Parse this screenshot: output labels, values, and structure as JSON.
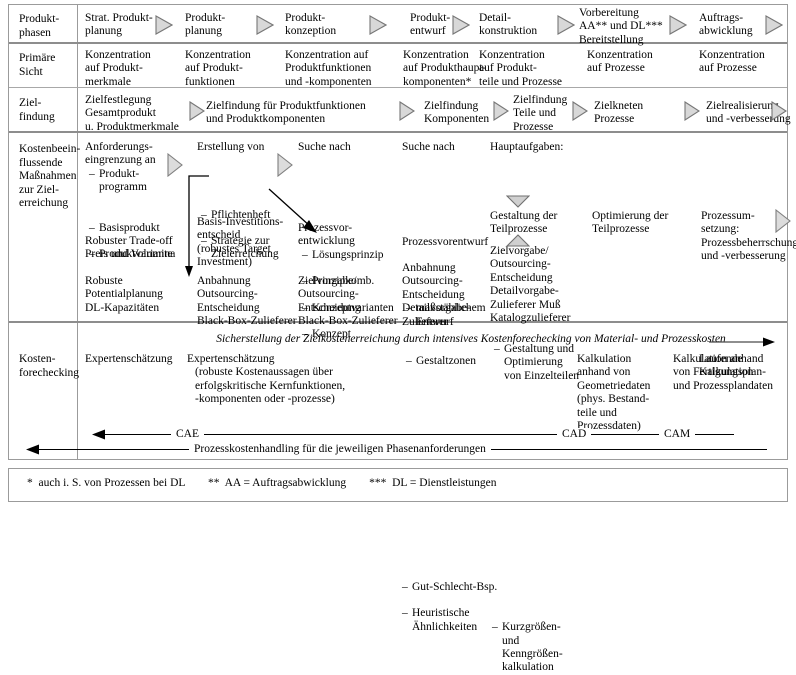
{
  "rows": {
    "produktphasen": {
      "label": "Produkt-\nphasen",
      "cells": [
        "Strat. Produkt-\nplanung",
        "Produkt-\nplanung",
        "Produkt-\nkonzeption",
        "Produkt-\nentwurf",
        "Detail-\nkonstruktion",
        "Vorbereitung\nAA** und DL***\nBereitstellung",
        "Auftrags-\nabwicklung"
      ]
    },
    "primaere_sicht": {
      "label": "Primäre\nSicht",
      "cells": [
        "Konzentration\nauf Produkt-\nmerkmale",
        "Konzentration\nauf Produkt-\nfunktionen",
        "Konzentration auf\nProduktfunktionen\nund -komponenten",
        "Konzentration\nauf Produkthaupt-\nkomponenten*",
        "Konzentration\nauf Produkt-\nteile und Prozesse",
        "Konzentration\nauf Prozesse",
        "Konzentration\nauf Prozesse"
      ]
    },
    "zielfindung": {
      "label": "Ziel-\nfindung",
      "cells": [
        "Zielfestlegung\nGesamtprodukt\nu. Produktmerkmale",
        "Zielfindung für Produktfunktionen\nund Produktkomponenten",
        "Zielfindung\nKomponenten",
        "Zielfindung\nTeile und\nProzesse",
        "Zielkneten\nProzesse",
        "Zielrealisierung\nund -verbesserung"
      ]
    },
    "massnahmen": {
      "label": "Kostenbeein-\nflussende\nMaßnahmen\nzur Ziel-\nerreichung",
      "c1_head": "Anforderungs-\neingrenzung an",
      "c1_items": [
        "Produkt-\nprogramm",
        "Basisprodukt",
        "Produktvariante"
      ],
      "c1_b": "Robuster Trade-off\nPreis und Volumina",
      "c1_c": "Robuste\nPotentialplanung\nDL-Kapazitäten",
      "c2_head": "Erstellung von",
      "c2_items": [
        "Pflichtenheft",
        "Strategie zur\nZielerreichung"
      ],
      "c2_b": "Basis-Investitions-\nentscheid\n(robustes Target\nInvestment)",
      "c2_c": "Anbahnung\nOutsourcing-\nEntscheidung\nBlack-Box-Zulieferer",
      "c3_head": "Suche nach",
      "c3_items": [
        "Lösungsprinzip",
        "Prinzipkomb.",
        "Konzeptvarianten",
        "Konzept"
      ],
      "c3_b": "Prozessvor-\nentwicklung",
      "c3_c": "Zielvorgabe/\nOutsourcing-\nEntscheidung\nBlack-Box-Zulieferer",
      "c4_head": "Suche nach",
      "c4_items": [
        "maßstäblichem\nEntwurf",
        "Gestaltzonen"
      ],
      "c4_b": "Prozessvorentwurf",
      "c5_head": "Hauptaufgaben:",
      "c5_items": [
        "Gestaltung und\nOptimierung\nvon Einzelteilen"
      ],
      "c5_b": "Gestaltung der\nTeilprozesse",
      "c5_c": "Zielvorgabe/\nOutsourcing-\nEntscheidung\nDetailvorgabe-\nZulieferer Muß\nKatalogzulieferer",
      "c6_b": "Optimierung der\nTeilprozesse",
      "c7_b": "Prozessum-\nsetzung:\nProzessbeherrschung\nund -verbesserung",
      "c4_c": "Anbahnung\nOutsourcing-\nEntscheidung\nDetailvorgabe-\nZulieferer"
    },
    "kostenforechecking": {
      "label": "Kosten-\nforechecking",
      "banner": "Sicherstellung der Zielkostenerreichung durch intensives Kostenforechecking von Material- und Prozesskosten",
      "cells": [
        "Expertenschätzung",
        "Expertenschätzung\n(robuste Kostenaussagen über\nerfolgskritische Kernfunktionen,\n-komponenten oder -prozesse)",
        "Gut-Schlecht-Bsp.\nHeuristische\nÄhnlichkeiten",
        "Kurzgrößen-\nund\nKenngrößen-\nkalkulation",
        "Kalkulation\nanhand von\nGeometriedaten\n(phys. Bestand-\nteile und\nProzessdaten)",
        "Kalkulation anhand\nvon Fertigungsplan-\nund Prozessplandaten",
        "Laufende\nKalkulation"
      ],
      "c3_items": [
        "Gut-Schlecht-Bsp.",
        "Heuristische\nÄhnlichkeiten"
      ],
      "c4_items": [
        "Kurzgrößen-\nund\nKenngrößen-\nkalkulation"
      ]
    }
  },
  "bands": {
    "cae": "CAE",
    "cad": "CAD",
    "cam": "CAM",
    "prozesskostenhandling": "Prozesskostenhandling für die jeweiligen Phasenanforderungen"
  },
  "footnote": "*  auch i. S. von Prozessen bei DL        **  AA = Auftragsabwicklung        ***  DL = Dienstleistungen",
  "colors": {
    "rule": "#9b9b9b",
    "rule_thick": "#8d8d8d",
    "arrow_fill": "#d4d4d4",
    "arrow_stroke": "#7a7a7a",
    "text": "#000000"
  }
}
